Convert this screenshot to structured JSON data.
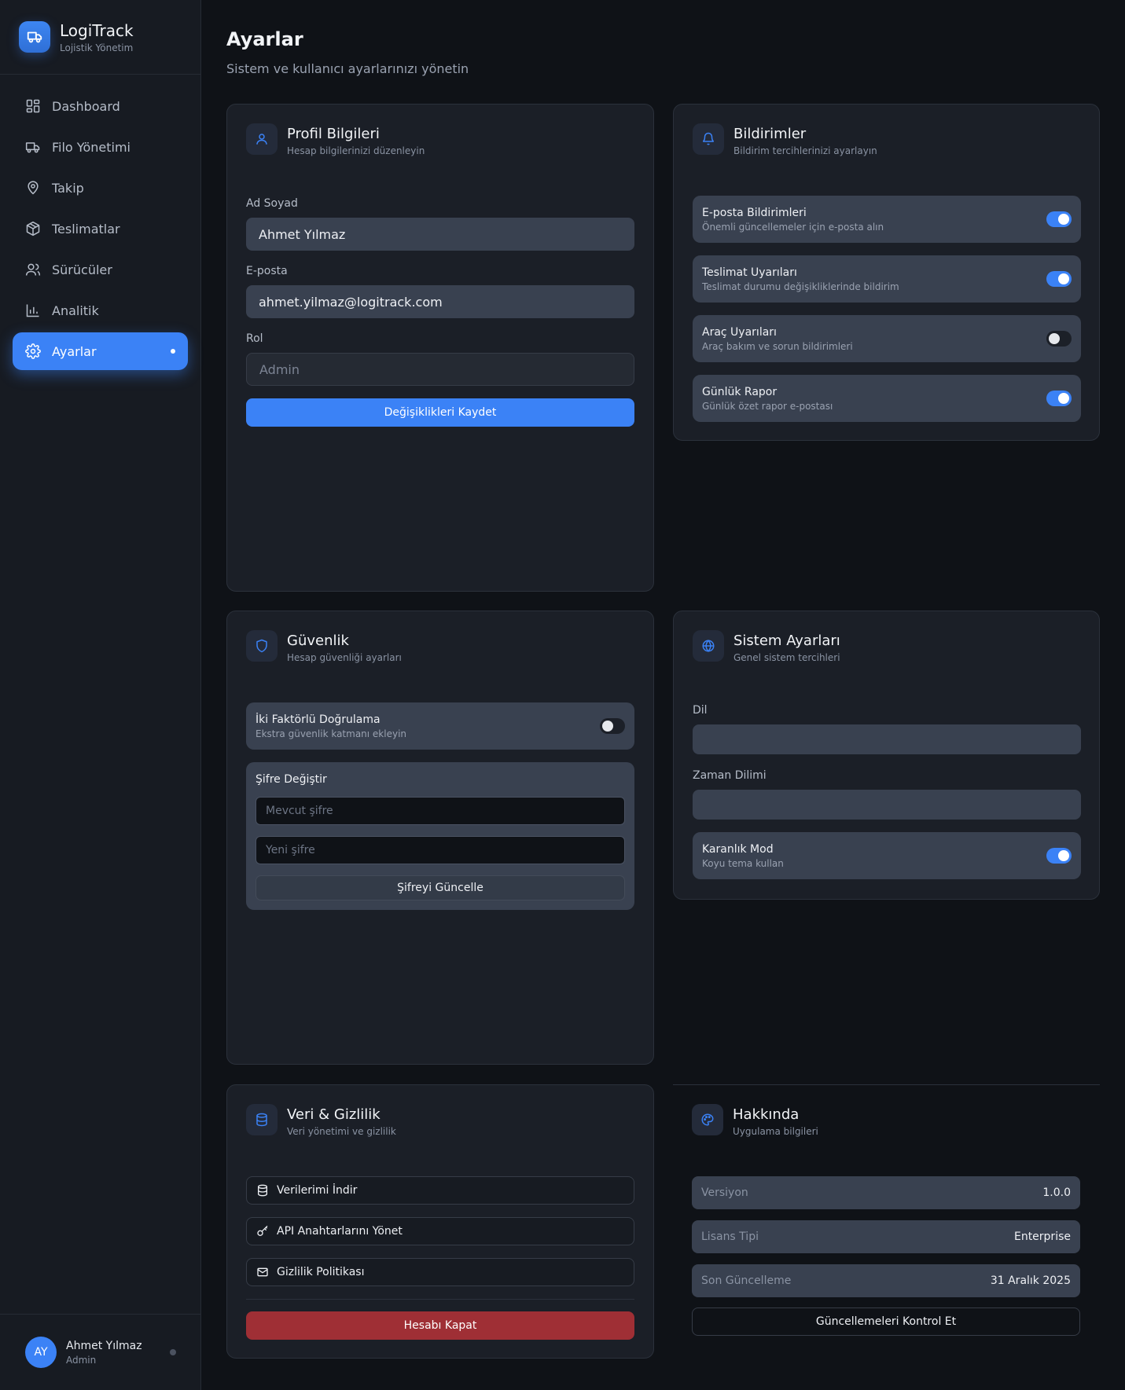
{
  "brand": {
    "title": "LogiTrack",
    "subtitle": "Lojistik Yönetim"
  },
  "nav": {
    "items": [
      {
        "label": "Dashboard",
        "icon": "grid-icon"
      },
      {
        "label": "Filo Yönetimi",
        "icon": "truck-icon"
      },
      {
        "label": "Takip",
        "icon": "map-pin-icon"
      },
      {
        "label": "Teslimatlar",
        "icon": "package-icon"
      },
      {
        "label": "Sürücüler",
        "icon": "users-icon"
      },
      {
        "label": "Analitik",
        "icon": "bar-chart-icon"
      },
      {
        "label": "Ayarlar",
        "icon": "gear-icon"
      }
    ],
    "active_index": 6
  },
  "user": {
    "initials": "AY",
    "name": "Ahmet Yılmaz",
    "role": "Admin"
  },
  "page": {
    "title": "Ayarlar",
    "subtitle": "Sistem ve kullanıcı ayarlarınızı yönetin"
  },
  "profile": {
    "title": "Profil Bilgileri",
    "subtitle": "Hesap bilgilerinizi düzenleyin",
    "name_label": "Ad Soyad",
    "name_value": "Ahmet Yılmaz",
    "email_label": "E-posta",
    "email_value": "ahmet.yilmaz@logitrack.com",
    "role_label": "Rol",
    "role_value": "Admin",
    "save_label": "Değişiklikleri Kaydet"
  },
  "notifications": {
    "title": "Bildirimler",
    "subtitle": "Bildirim tercihlerinizi ayarlayın",
    "items": [
      {
        "title": "E-posta Bildirimleri",
        "desc": "Önemli güncellemeler için e-posta alın",
        "on": true
      },
      {
        "title": "Teslimat Uyarıları",
        "desc": "Teslimat durumu değişikliklerinde bildirim",
        "on": true
      },
      {
        "title": "Araç Uyarıları",
        "desc": "Araç bakım ve sorun bildirimleri",
        "on": false
      },
      {
        "title": "Günlük Rapor",
        "desc": "Günlük özet rapor e-postası",
        "on": true
      }
    ]
  },
  "security": {
    "title": "Güvenlik",
    "subtitle": "Hesap güvenliği ayarları",
    "two_factor_title": "İki Faktörlü Doğrulama",
    "two_factor_desc": "Ekstra güvenlik katmanı ekleyin",
    "two_factor_on": false,
    "password_title": "Şifre Değiştir",
    "current_placeholder": "Mevcut şifre",
    "new_placeholder": "Yeni şifre",
    "update_label": "Şifreyi Güncelle"
  },
  "system": {
    "title": "Sistem Ayarları",
    "subtitle": "Genel sistem tercihleri",
    "language_label": "Dil",
    "timezone_label": "Zaman Dilimi",
    "dark_title": "Karanlık Mod",
    "dark_desc": "Koyu tema kullan",
    "dark_on": true
  },
  "data": {
    "title": "Veri & Gizlilik",
    "subtitle": "Veri yönetimi ve gizlilik",
    "download_label": "Verilerimi İndir",
    "api_label": "API Anahtarlarını Yönet",
    "privacy_label": "Gizlilik Politikası",
    "close_label": "Hesabı Kapat"
  },
  "about": {
    "title": "Hakkında",
    "subtitle": "Uygulama bilgileri",
    "rows": [
      {
        "key": "Versiyon",
        "value": "1.0.0"
      },
      {
        "key": "Lisans Tipi",
        "value": "Enterprise"
      },
      {
        "key": "Son Güncelleme",
        "value": "31 Aralık 2025"
      }
    ],
    "check_label": "Güncellemeleri Kontrol Et"
  },
  "colors": {
    "accent": "#3b82f6",
    "danger": "#9f2f35",
    "background": "#0f1217",
    "card": "#1b1f27"
  }
}
